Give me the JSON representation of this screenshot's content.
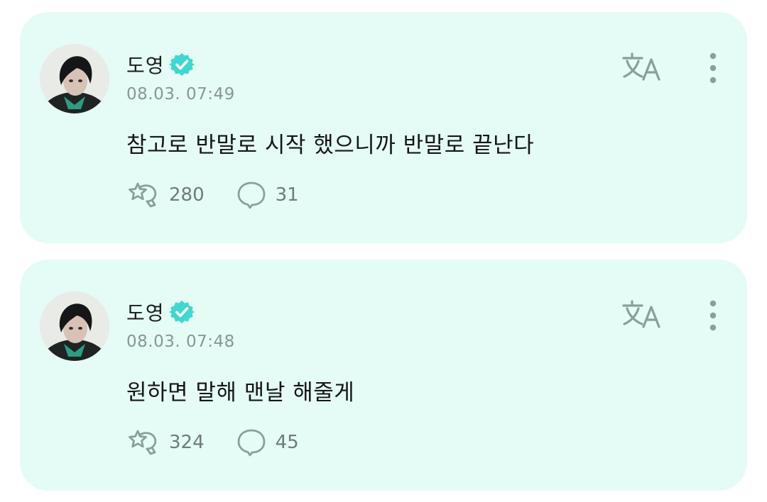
{
  "colors": {
    "card_background": "#e4fbf6",
    "verified_badge": "#3fd8d0",
    "icon_gray": "#88a09c",
    "meta_text": "#8a9695"
  },
  "posts": [
    {
      "author": "도영",
      "verified": true,
      "timestamp": "08.03. 07:49",
      "text": "참고로 반말로 시작 했으니까 반말로 끝난다",
      "likes": "280",
      "comments": "31",
      "icons": {
        "translate": "translate-icon",
        "more": "more-vertical-icon",
        "like": "like-icon",
        "comment": "comment-icon"
      }
    },
    {
      "author": "도영",
      "verified": true,
      "timestamp": "08.03. 07:48",
      "text": "원하면 말해 맨날 해줄게",
      "likes": "324",
      "comments": "45",
      "icons": {
        "translate": "translate-icon",
        "more": "more-vertical-icon",
        "like": "like-icon",
        "comment": "comment-icon"
      }
    }
  ]
}
